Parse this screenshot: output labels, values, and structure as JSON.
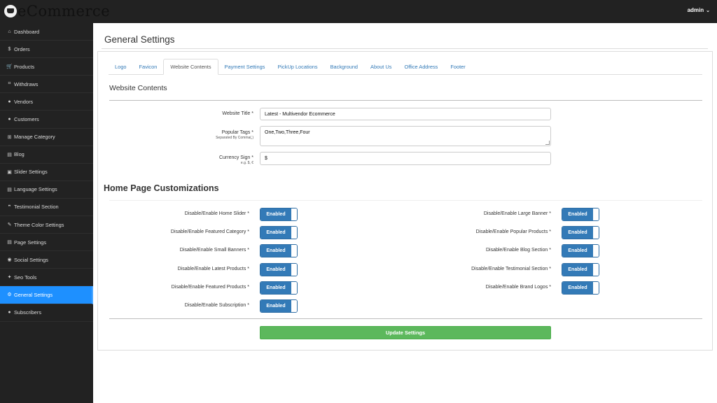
{
  "brand": {
    "name": "eCommerce",
    "logo_icon": "cart-logo-icon"
  },
  "user": {
    "name": "admin",
    "menu_icon": "chevron-down-icon"
  },
  "sidebar": {
    "items": [
      {
        "label": "Dashboard",
        "icon": "home-icon",
        "glyph": "⌂"
      },
      {
        "label": "Orders",
        "icon": "dollar-icon",
        "glyph": "$"
      },
      {
        "label": "Products",
        "icon": "cart-icon",
        "glyph": "🛒"
      },
      {
        "label": "Withdraws",
        "icon": "bank-icon",
        "glyph": "⌗"
      },
      {
        "label": "Vendors",
        "icon": "user-icon",
        "glyph": "●"
      },
      {
        "label": "Customers",
        "icon": "user-icon",
        "glyph": "●"
      },
      {
        "label": "Manage Category",
        "icon": "sitemap-icon",
        "glyph": "⊞"
      },
      {
        "label": "Blog",
        "icon": "file-icon",
        "glyph": "▤"
      },
      {
        "label": "Slider Settings",
        "icon": "image-icon",
        "glyph": "▣"
      },
      {
        "label": "Language Settings",
        "icon": "file-text-icon",
        "glyph": "▤"
      },
      {
        "label": "Testimonial Section",
        "icon": "quote-icon",
        "glyph": "❞"
      },
      {
        "label": "Theme Color Settings",
        "icon": "brush-icon",
        "glyph": "✎"
      },
      {
        "label": "Page Settings",
        "icon": "file-icon",
        "glyph": "▤"
      },
      {
        "label": "Social Settings",
        "icon": "globe-icon",
        "glyph": "◉"
      },
      {
        "label": "Seo Tools",
        "icon": "wrench-icon",
        "glyph": "✦"
      },
      {
        "label": "General Settings",
        "icon": "cogs-icon",
        "glyph": "⚙"
      },
      {
        "label": "Subscribers",
        "icon": "users-icon",
        "glyph": "●"
      }
    ],
    "active_index": 15
  },
  "page": {
    "title": "General Settings"
  },
  "tabs": [
    {
      "label": "Logo"
    },
    {
      "label": "Favicon"
    },
    {
      "label": "Website Contents"
    },
    {
      "label": "Payment Settings"
    },
    {
      "label": "PickUp Locations"
    },
    {
      "label": "Background"
    },
    {
      "label": "About Us"
    },
    {
      "label": "Office Address"
    },
    {
      "label": "Footer"
    }
  ],
  "active_tab": 2,
  "website_contents": {
    "heading": "Website Contents",
    "website_title": {
      "label": "Website Title *",
      "value": "Latest - Multivendor Ecommerce"
    },
    "popular_tags": {
      "label": "Popular Tags *",
      "hint": "Separated By Comma(,)",
      "value": "One,Two,Three,Four"
    },
    "currency_sign": {
      "label": "Currency Sign *",
      "hint": "e.g. $, €",
      "value": "$"
    }
  },
  "home_page": {
    "heading": "Home Page Customizations",
    "left_toggles": [
      {
        "label": "Disable/Enable Home Slider *",
        "state": "Enabled"
      },
      {
        "label": "Disable/Enable Featured Category *",
        "state": "Enabled"
      },
      {
        "label": "Disable/Enable Small Banners *",
        "state": "Enabled"
      },
      {
        "label": "Disable/Enable Latest Products *",
        "state": "Enabled"
      },
      {
        "label": "Disable/Enable Featured Products *",
        "state": "Enabled"
      },
      {
        "label": "Disable/Enable Subscription *",
        "state": "Enabled"
      }
    ],
    "right_toggles": [
      {
        "label": "Disable/Enable Large Banner *",
        "state": "Enabled"
      },
      {
        "label": "Disable/Enable Popular Products *",
        "state": "Enabled"
      },
      {
        "label": "Disable/Enable Blog Section *",
        "state": "Enabled"
      },
      {
        "label": "Disable/Enable Testimonial Section *",
        "state": "Enabled"
      },
      {
        "label": "Disable/Enable Brand Logos *",
        "state": "Enabled"
      }
    ]
  },
  "actions": {
    "update_label": "Update Settings"
  },
  "colors": {
    "sidebar_bg": "#222222",
    "active_item": "#1e90ff",
    "toggle_on": "#337ab7",
    "update_btn": "#5cb85c",
    "link": "#337ab7"
  }
}
